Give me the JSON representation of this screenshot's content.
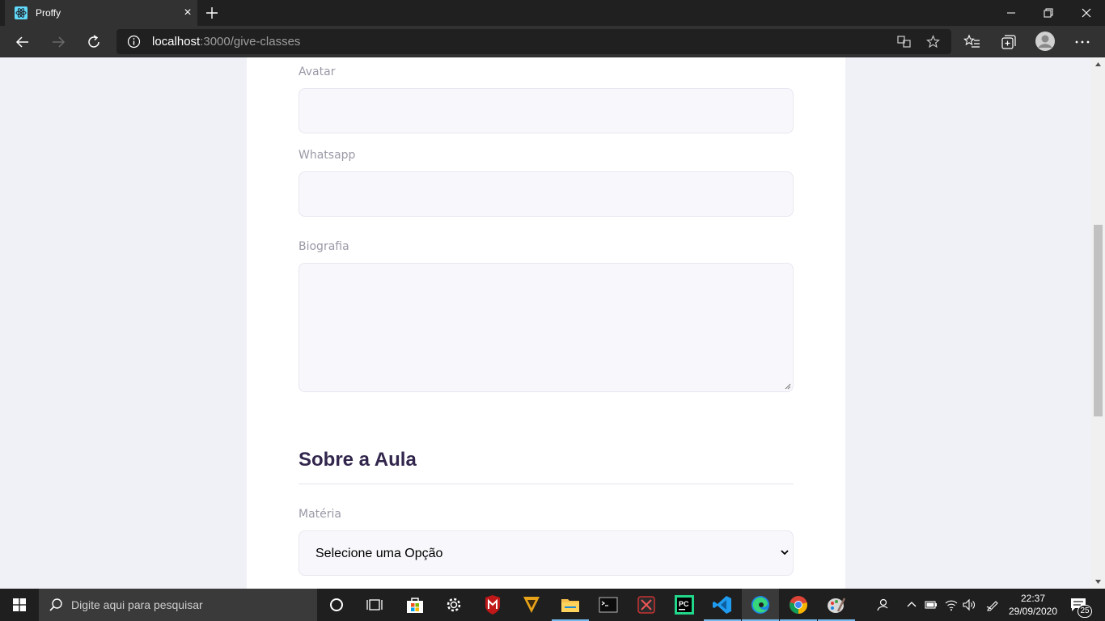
{
  "browser": {
    "tab_title": "Proffy",
    "url_host": "localhost",
    "url_path": ":3000/give-classes"
  },
  "form": {
    "fields": [
      {
        "label": "Avatar",
        "value": ""
      },
      {
        "label": "Whatsapp",
        "value": ""
      },
      {
        "label": "Biografia",
        "value": ""
      }
    ],
    "section_title": "Sobre a Aula",
    "subject_label": "Matéria",
    "subject_select": "Selecione uma Opção"
  },
  "taskbar": {
    "search_placeholder": "Digite aqui para pesquisar",
    "time": "22:37",
    "date": "29/09/2020",
    "notifications": "25",
    "pinned": [
      "cortana-icon",
      "task-view-icon",
      "store-icon",
      "settings-icon",
      "mcafee-icon",
      "game-icon",
      "file-explorer-icon",
      "terminal-icon",
      "media-icon",
      "pycharm-icon",
      "vscode-icon",
      "edge-icon",
      "chrome-icon",
      "paint-icon"
    ]
  },
  "colors": {
    "page_bg": "#f0f0f7",
    "input_bg": "#f8f8fc",
    "input_border": "#e6e6f0",
    "label": "#9c98a6",
    "title": "#32264d",
    "chrome_dark": "#202020",
    "chrome_mid": "#323232"
  }
}
